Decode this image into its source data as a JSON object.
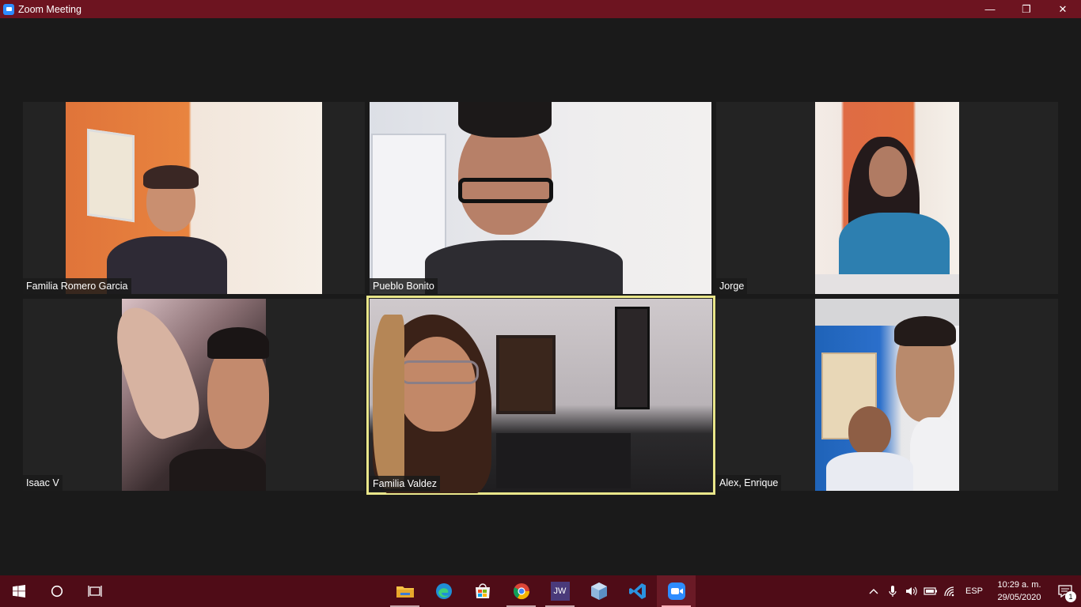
{
  "window": {
    "title": "Zoom Meeting",
    "controls": {
      "minimize": "—",
      "restore": "❐",
      "close": "✕"
    }
  },
  "participants": [
    {
      "name": "Familia Romero Garcia",
      "active": false
    },
    {
      "name": "Pueblo Bonito",
      "active": false
    },
    {
      "name": "Jorge",
      "active": false
    },
    {
      "name": "Isaac V",
      "active": false
    },
    {
      "name": "Familia Valdez",
      "active": true
    },
    {
      "name": "Alex, Enrique",
      "active": false
    }
  ],
  "taskbar": {
    "apps": [
      {
        "name": "file-explorer-icon"
      },
      {
        "name": "edge-icon"
      },
      {
        "name": "store-icon"
      },
      {
        "name": "chrome-icon"
      },
      {
        "name": "jw-library-icon",
        "label": "JW"
      },
      {
        "name": "virtualbox-icon"
      },
      {
        "name": "vscode-icon"
      },
      {
        "name": "zoom-icon"
      }
    ],
    "language": "ESP",
    "time": "10:29 a. m.",
    "date": "29/05/2020",
    "notification_count": "1"
  }
}
